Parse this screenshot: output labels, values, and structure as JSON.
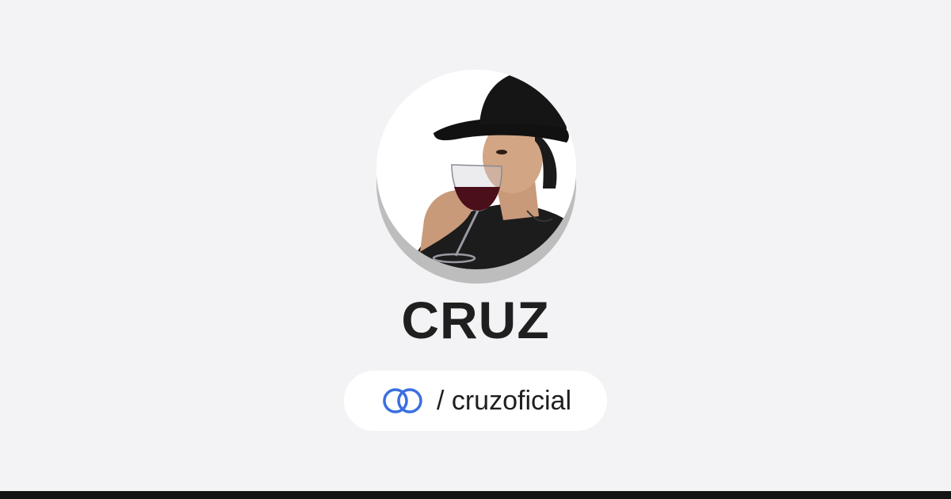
{
  "profile": {
    "name": "CRUZ",
    "handle": "/ cruzoficial",
    "avatar_icon": "profile-photo",
    "link_icon": "linked-rings-icon"
  },
  "colors": {
    "background": "#f3f3f5",
    "text": "#1f1f1f",
    "pill": "#ffffff",
    "link_icon": "#3b6fe0",
    "bottom_bar": "#141414"
  }
}
